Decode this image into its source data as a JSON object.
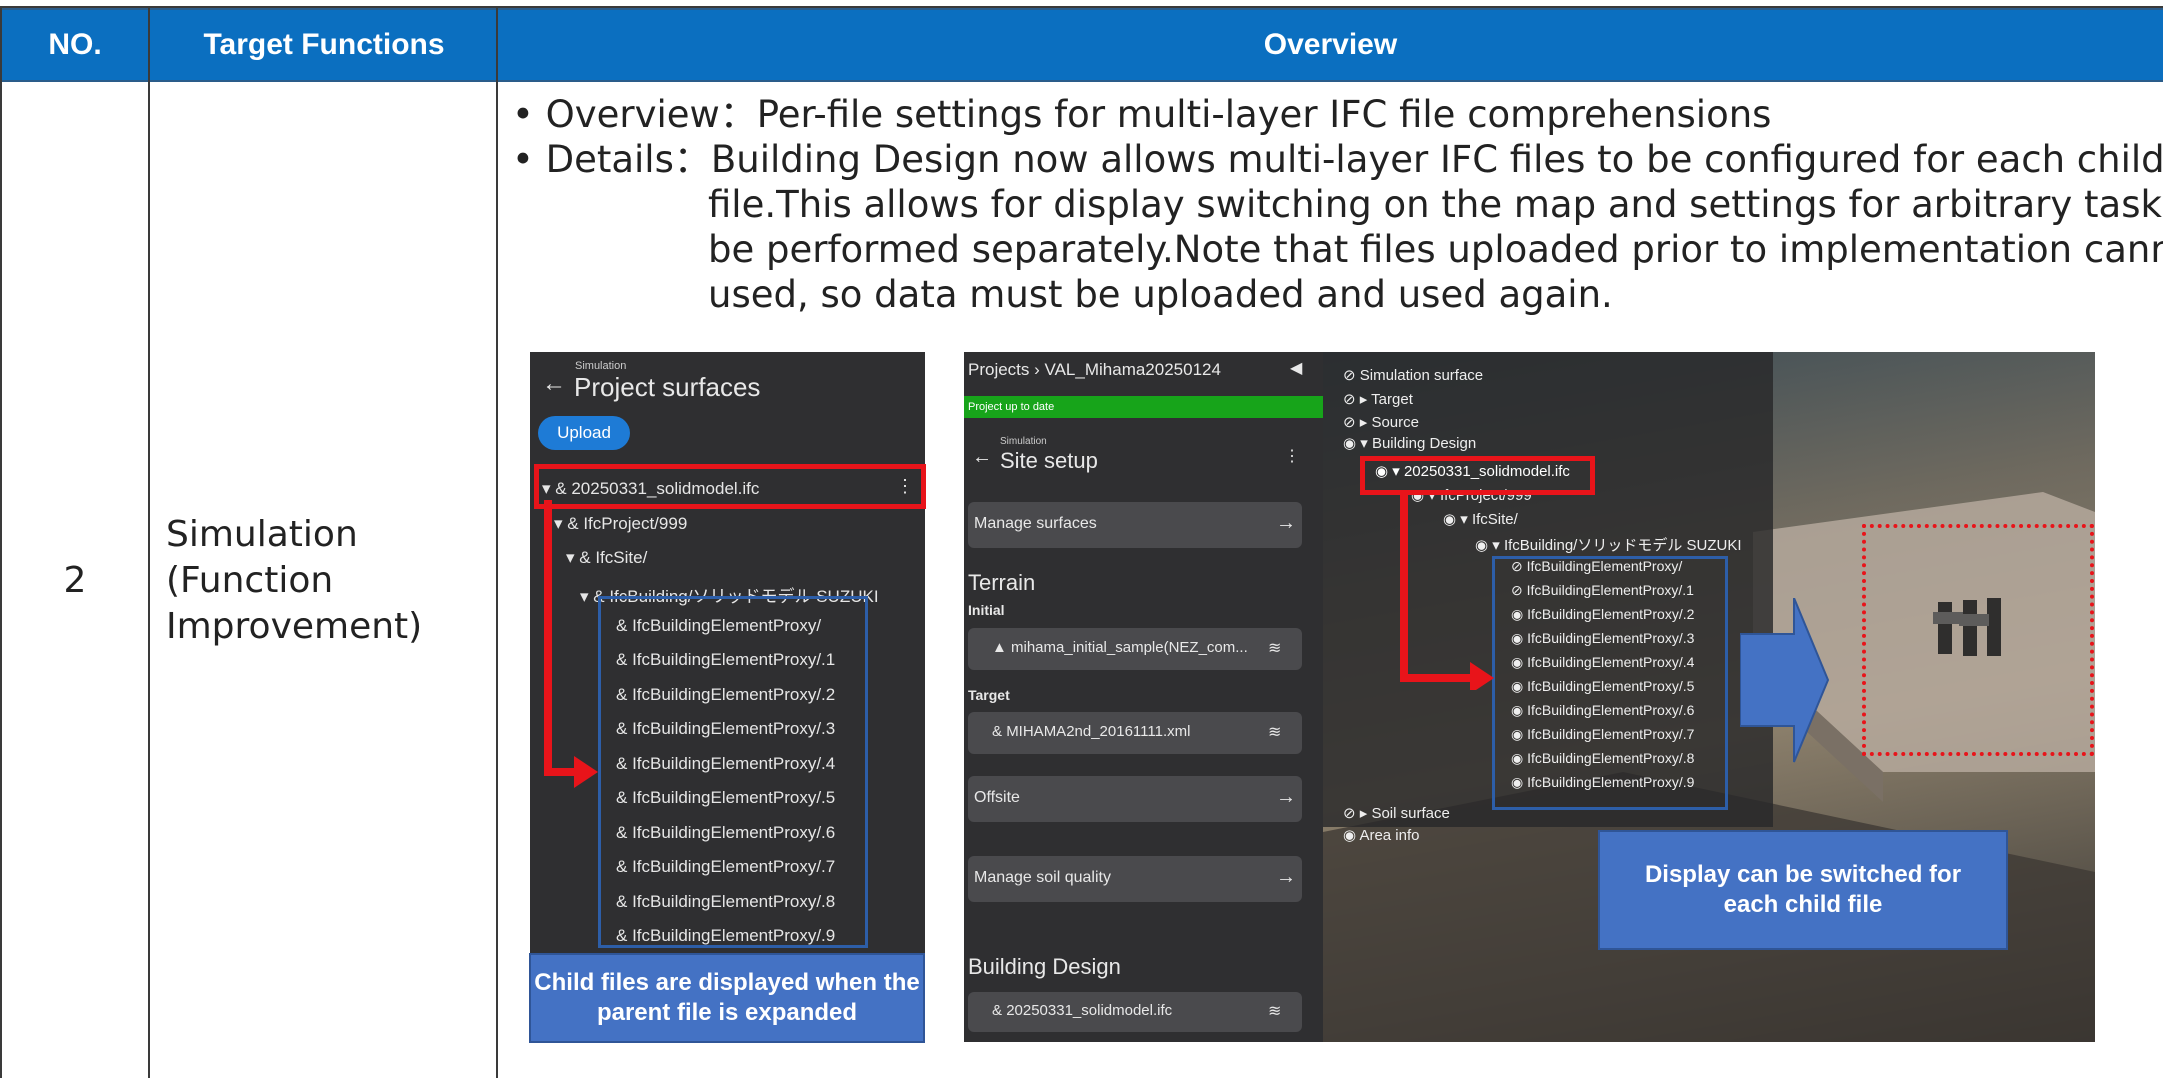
{
  "table": {
    "headers": {
      "no": "NO.",
      "functions": "Target Functions",
      "overview": "Overview"
    },
    "row": {
      "no": "2",
      "function_lines": [
        "Simulation",
        "(Function",
        "Improvement)"
      ],
      "overview_line": "• Overview：Per-file settings for multi-layer IFC file comprehensions",
      "details_line1": "• Details：Building Design now allows multi-layer IFC files to be configured for each child",
      "details_line2": "file.This allows for display switching on the map and settings for arbitrary tasks to",
      "details_line3": "be performed separately.Note that files uploaded prior to implementation cannot be",
      "details_line4": "used, so data must be uploaded and used again."
    }
  },
  "left_panel": {
    "breadcrumb": "Simulation",
    "title": "Project surfaces",
    "upload_label": "Upload",
    "parent_file": "20250331_solidmodel.ifc",
    "tree": [
      "IfcProject/999",
      "IfcSite/",
      "IfcBuilding/ソリッドモデル SUZUKI"
    ],
    "children": [
      "IfcBuildingElementProxy/",
      "IfcBuildingElementProxy/.1",
      "IfcBuildingElementProxy/.2",
      "IfcBuildingElementProxy/.3",
      "IfcBuildingElementProxy/.4",
      "IfcBuildingElementProxy/.5",
      "IfcBuildingElementProxy/.6",
      "IfcBuildingElementProxy/.7",
      "IfcBuildingElementProxy/.8",
      "IfcBuildingElementProxy/.9"
    ],
    "callout": "Child files are displayed when the parent file is expanded"
  },
  "right_panel": {
    "breadcrumb": "Projects › VAL_Mihama20250124",
    "status": "Project up to date",
    "sub_breadcrumb": "Simulation",
    "title": "Site setup",
    "manage_surfaces": "Manage surfaces",
    "terrain_heading": "Terrain",
    "initial_label": "Initial",
    "initial_value": "mihama_initial_sample(NEZ_com...",
    "target_label": "Target",
    "target_value": "MIHAMA2nd_20161111.xml",
    "offsite": "Offsite",
    "manage_soil": "Manage soil quality",
    "building_heading": "Building Design",
    "building_value": "20250331_solidmodel.ifc"
  },
  "map_layers": {
    "top": [
      "Simulation surface",
      "Target",
      "Source",
      "Building Design"
    ],
    "parent_file": "20250331_solidmodel.ifc",
    "tree": [
      "IfcProject/999",
      "IfcSite/",
      "IfcBuilding/ソリッドモデル SUZUKI"
    ],
    "children": [
      "IfcBuildingElementProxy/",
      "IfcBuildingElementProxy/.1",
      "IfcBuildingElementProxy/.2",
      "IfcBuildingElementProxy/.3",
      "IfcBuildingElementProxy/.4",
      "IfcBuildingElementProxy/.5",
      "IfcBuildingElementProxy/.6",
      "IfcBuildingElementProxy/.7",
      "IfcBuildingElementProxy/.8",
      "IfcBuildingElementProxy/.9"
    ],
    "bottom": [
      "Soil surface",
      "Area info"
    ],
    "callout": "Display can be switched for each child file"
  },
  "colors": {
    "header": "#0b6fc0",
    "highlight": "#e8141a",
    "callout": "#4472c4",
    "status": "#17a41a"
  }
}
